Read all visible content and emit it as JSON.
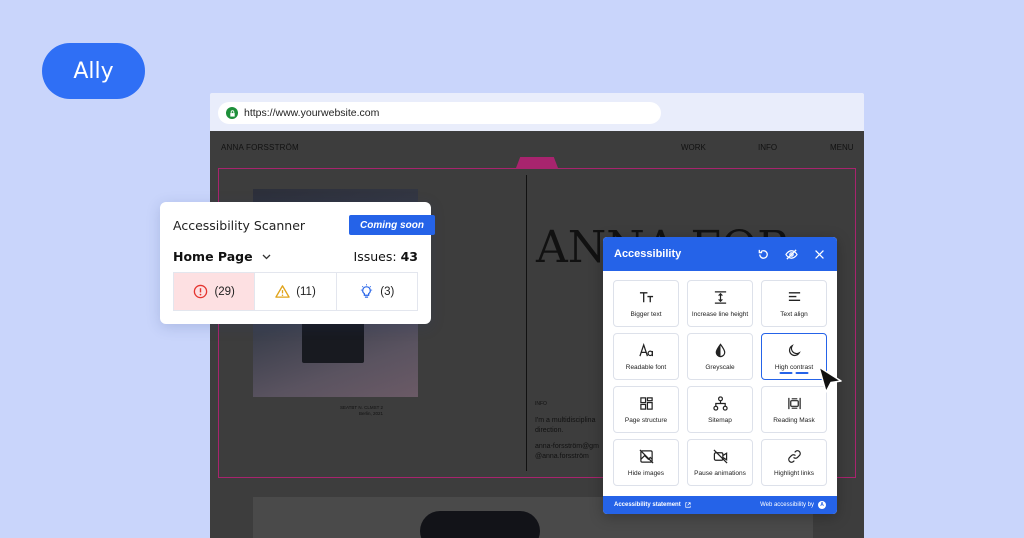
{
  "badge": {
    "label": "Ally"
  },
  "browser": {
    "url": "https://www.yourwebsite.com"
  },
  "site": {
    "name": "ANNA FORSSTRÖM",
    "nav": [
      "WORK",
      "INFO",
      "MENU"
    ],
    "hero": "ANNA FOR",
    "caption_1": "SEATBT N. CLMST 2",
    "caption_2": "Berlin, 2021",
    "info_label": "INFO",
    "info_text": "I'm a multidisciplina direction.",
    "email": "anna-forsström@gm",
    "handle": "@anna.forsström"
  },
  "scanner": {
    "title": "Accessibility Scanner",
    "badge": "Coming soon",
    "page": "Home Page",
    "issues_label": "Issues:",
    "issues_count": "43",
    "errors": "(29)",
    "warnings": "(11)",
    "suggestions": "(3)",
    "colors": {
      "error": "#e5342f",
      "warning": "#e0a31a",
      "suggestion": "#2563e8"
    }
  },
  "a11y": {
    "title": "Accessibility",
    "tiles": [
      {
        "label": "Bigger text",
        "icon": "text-size-icon"
      },
      {
        "label": "Increase line height",
        "icon": "line-height-icon"
      },
      {
        "label": "Text align",
        "icon": "text-align-icon"
      },
      {
        "label": "Readable font",
        "icon": "font-icon"
      },
      {
        "label": "Greyscale",
        "icon": "drop-icon"
      },
      {
        "label": "High contrast",
        "icon": "moon-icon",
        "active": true
      },
      {
        "label": "Page structure",
        "icon": "structure-icon"
      },
      {
        "label": "Sitemap",
        "icon": "sitemap-icon"
      },
      {
        "label": "Reading Mask",
        "icon": "mask-icon"
      },
      {
        "label": "Hide images",
        "icon": "image-icon"
      },
      {
        "label": "Pause animations",
        "icon": "video-off-icon"
      },
      {
        "label": "Highlight links",
        "icon": "link-icon"
      }
    ],
    "footer_statement": "Accessibility statement",
    "footer_by": "Web accessibility by",
    "footer_logo": "A",
    "accent": "#2563e8"
  }
}
